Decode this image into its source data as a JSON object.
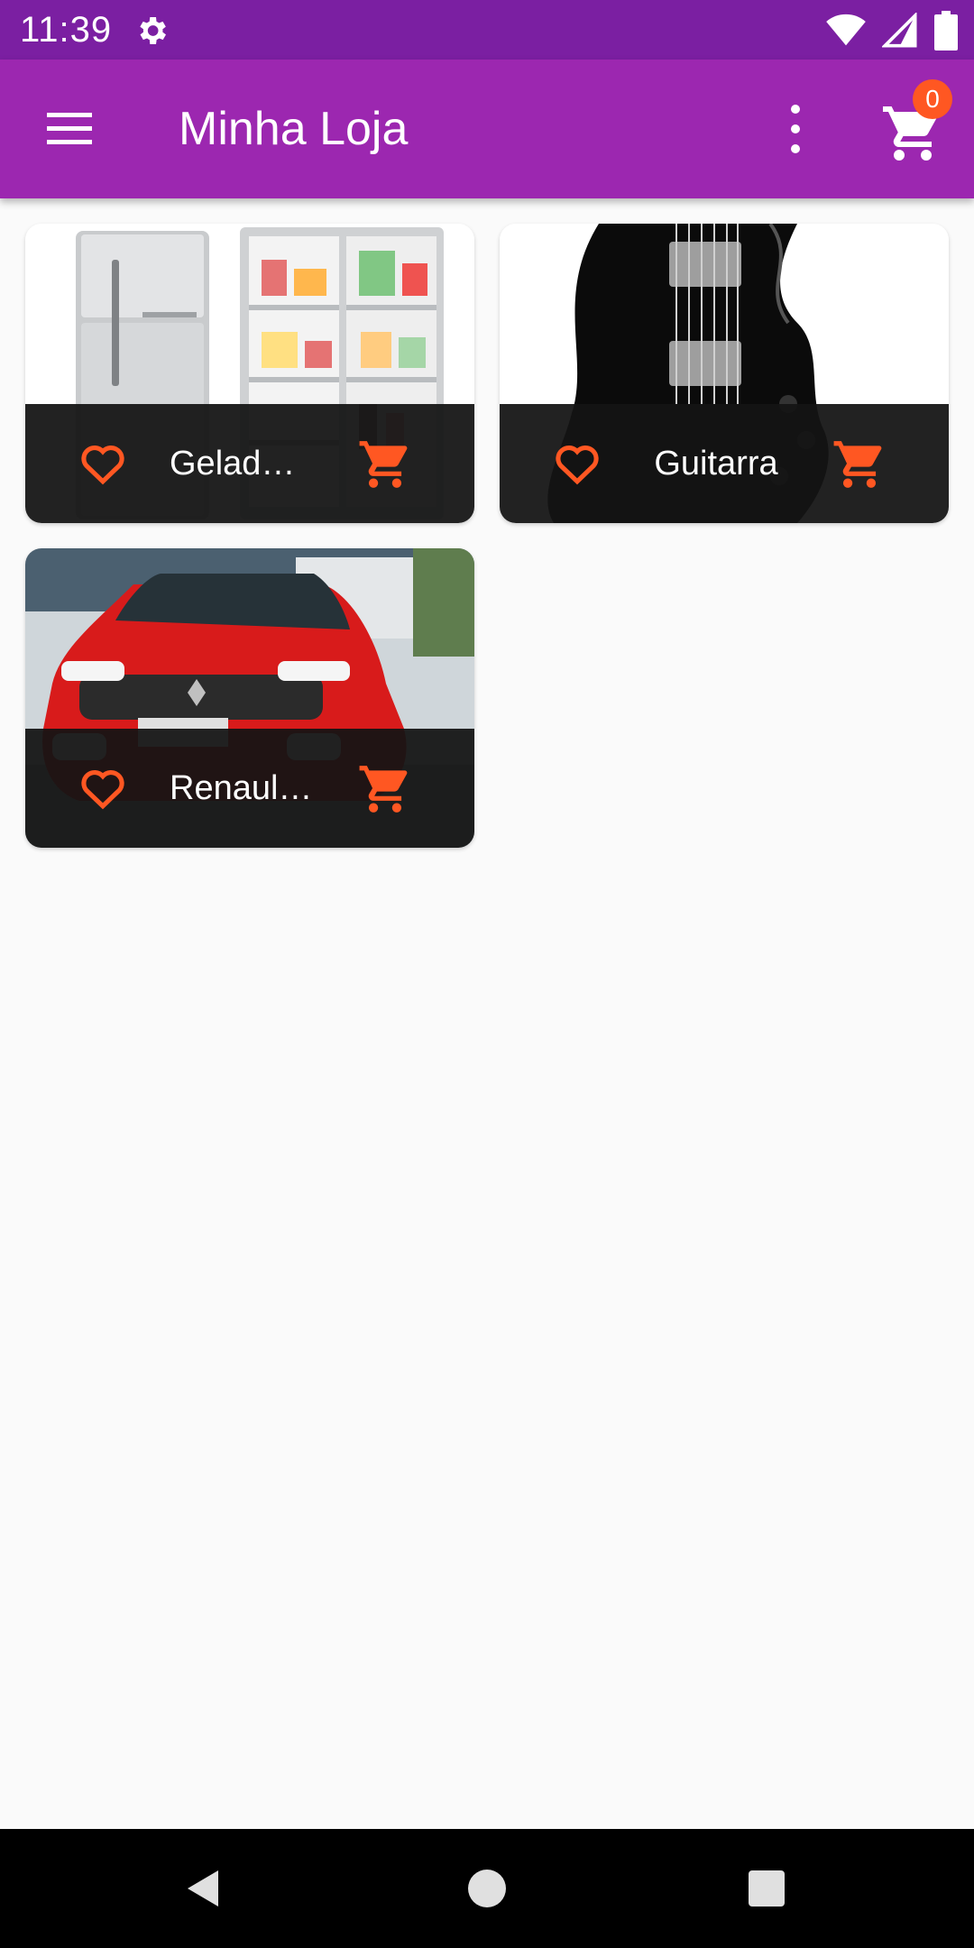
{
  "status_bar": {
    "time": "11:39",
    "icons": [
      "settings-icon",
      "wifi-icon",
      "signal-icon",
      "battery-icon"
    ]
  },
  "app_bar": {
    "title": "Minha Loja",
    "cart_count": "0",
    "background": "#9c27b0",
    "status_color": "#7b1fa2",
    "accent": "#ff5722"
  },
  "products": [
    {
      "name": "Geladeira",
      "image": "refrigerator"
    },
    {
      "name": "Guitarra",
      "image": "electric-guitar"
    },
    {
      "name": "Renault Kwid",
      "image": "red-car"
    }
  ],
  "nav_bar": {
    "buttons": [
      "back",
      "home",
      "recents"
    ]
  }
}
